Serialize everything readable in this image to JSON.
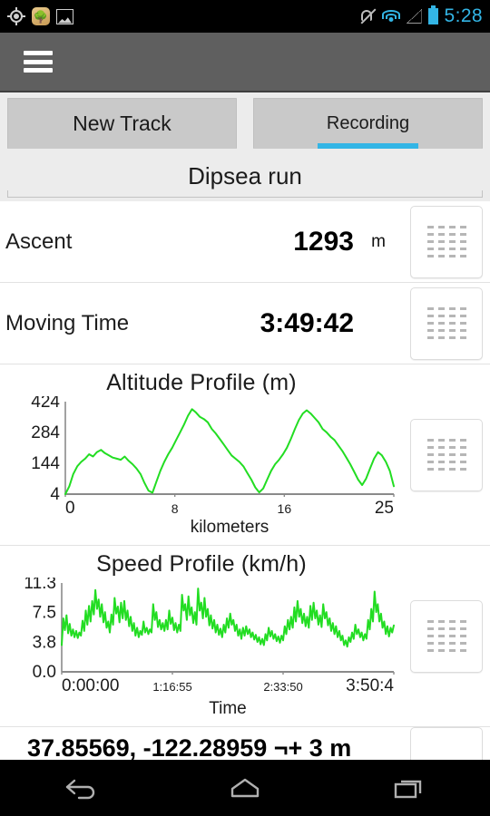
{
  "status_bar": {
    "time": "5:28",
    "left_icons": [
      "gps-crosshair-icon",
      "nature-app-icon",
      "photo-icon"
    ],
    "right_icons": [
      "mute-icon",
      "wifi-icon",
      "signal-icon",
      "battery-icon"
    ],
    "accent_color": "#33B5E5"
  },
  "action_bar": {
    "menu_icon": "hamburger-menu-icon",
    "background_color": "#5F5F5F"
  },
  "tabs": [
    {
      "label": "New Track",
      "active": false
    },
    {
      "label": "Recording",
      "active": true
    }
  ],
  "track": {
    "name": "Dipsea run"
  },
  "stats": [
    {
      "label": "Ascent",
      "value": "1293",
      "unit": "m"
    },
    {
      "label": "Moving Time",
      "value": "3:49:42",
      "unit": ""
    }
  ],
  "coordinates": {
    "text": "37.85569, -122.28959 ¬+ 3 m"
  },
  "side_icon": "drag-handle-grid-icon",
  "nav_bar": {
    "buttons": [
      "back-icon",
      "home-icon",
      "recents-icon"
    ]
  },
  "chart_data": [
    {
      "type": "line",
      "title": "Altitude Profile (m)",
      "xlabel": "kilometers",
      "ylabel": "",
      "line_color": "#22DD22",
      "grid": false,
      "legend": "none",
      "xticks": [
        "0",
        "8",
        "16",
        "25"
      ],
      "yticks": [
        "4",
        "144",
        "284",
        "424"
      ],
      "xlim": [
        0,
        25
      ],
      "ylim": [
        4,
        424
      ],
      "x": [
        0.0,
        0.3,
        0.6,
        0.9,
        1.2,
        1.5,
        1.8,
        2.1,
        2.4,
        2.7,
        3.0,
        3.3,
        3.6,
        3.9,
        4.2,
        4.5,
        4.8,
        5.1,
        5.4,
        5.7,
        6.0,
        6.3,
        6.6,
        6.9,
        7.2,
        7.5,
        7.8,
        8.1,
        8.4,
        8.7,
        9.0,
        9.3,
        9.6,
        9.9,
        10.2,
        10.5,
        10.8,
        11.1,
        11.4,
        11.7,
        12.0,
        12.3,
        12.6,
        12.9,
        13.2,
        13.5,
        13.8,
        14.1,
        14.4,
        14.7,
        15.0,
        15.3,
        15.6,
        15.9,
        16.2,
        16.5,
        16.8,
        17.1,
        17.4,
        17.7,
        18.0,
        18.3,
        18.6,
        18.9,
        19.2,
        19.5,
        19.8,
        20.1,
        20.4,
        20.7,
        21.0,
        21.3,
        21.6,
        21.9,
        22.2,
        22.5,
        22.8,
        23.1,
        23.4,
        23.7,
        24.0,
        24.3,
        24.6,
        25.0
      ],
      "values": [
        4,
        40,
        95,
        130,
        150,
        165,
        185,
        175,
        195,
        205,
        190,
        180,
        170,
        165,
        160,
        175,
        155,
        140,
        120,
        95,
        55,
        20,
        10,
        60,
        110,
        150,
        185,
        215,
        250,
        285,
        320,
        360,
        390,
        375,
        355,
        345,
        330,
        300,
        280,
        255,
        230,
        205,
        180,
        165,
        150,
        130,
        100,
        70,
        35,
        12,
        30,
        70,
        110,
        140,
        160,
        185,
        215,
        255,
        300,
        340,
        370,
        385,
        370,
        350,
        330,
        300,
        285,
        265,
        250,
        225,
        200,
        170,
        140,
        105,
        70,
        45,
        75,
        120,
        165,
        195,
        180,
        150,
        110,
        40
      ]
    },
    {
      "type": "line",
      "title": "Speed Profile (km/h)",
      "xlabel": "Time",
      "ylabel": "",
      "line_color": "#22DD22",
      "grid": false,
      "legend": "none",
      "xticks": [
        "0:00:00",
        "1:16:55",
        "2:33:50",
        "3:50:4"
      ],
      "yticks": [
        "0.0",
        "3.8",
        "7.5",
        "11.3"
      ],
      "xlim": [
        0,
        100
      ],
      "ylim": [
        0,
        11.3
      ],
      "values": [
        3.4,
        6.8,
        5.3,
        7.2,
        4.9,
        6.1,
        4.6,
        5.4,
        4.4,
        5.2,
        4.3,
        5.0,
        4.6,
        6.5,
        5.2,
        7.8,
        6.0,
        8.4,
        6.4,
        9.0,
        7.3,
        10.4,
        8.0,
        9.2,
        7.0,
        8.6,
        6.3,
        7.6,
        5.6,
        6.4,
        5.0,
        7.3,
        6.0,
        9.4,
        7.4,
        8.3,
        6.3,
        8.8,
        6.8,
        9.0,
        6.6,
        7.8,
        5.8,
        7.0,
        5.2,
        6.2,
        4.6,
        5.6,
        4.4,
        5.2,
        4.7,
        6.4,
        5.0,
        5.6,
        4.8,
        5.4,
        5.0,
        8.6,
        6.6,
        7.6,
        5.7,
        6.6,
        5.4,
        6.2,
        5.2,
        6.6,
        5.4,
        7.8,
        6.1,
        6.9,
        5.3,
        6.2,
        5.0,
        6.0,
        5.2,
        9.8,
        7.8,
        8.6,
        6.6,
        9.6,
        7.2,
        8.2,
        6.2,
        7.6,
        6.0,
        10.6,
        7.8,
        8.8,
        6.8,
        9.4,
        7.0,
        8.0,
        5.9,
        7.2,
        5.5,
        6.6,
        5.0,
        6.0,
        4.7,
        5.5,
        4.4,
        6.0,
        5.0,
        6.8,
        5.6,
        7.4,
        6.0,
        6.6,
        5.2,
        6.0,
        4.6,
        5.4,
        4.2,
        5.6,
        4.6,
        5.8,
        4.8,
        5.4,
        4.4,
        5.0,
        4.1,
        4.7,
        3.8,
        4.4,
        3.5,
        4.2,
        3.4,
        4.8,
        4.0,
        5.6,
        4.5,
        5.2,
        4.2,
        4.8,
        3.9,
        4.5,
        3.7,
        4.6,
        4.0,
        5.8,
        4.8,
        6.6,
        5.4,
        7.0,
        5.6,
        8.2,
        6.4,
        9.0,
        7.0,
        8.0,
        6.2,
        7.4,
        5.8,
        7.0,
        5.6,
        8.4,
        6.6,
        8.8,
        6.8,
        7.8,
        6.0,
        7.2,
        5.7,
        8.6,
        6.8,
        7.6,
        5.9,
        6.8,
        5.2,
        6.2,
        4.8,
        5.8,
        4.4,
        5.2,
        4.0,
        4.6,
        3.4,
        4.0,
        3.2,
        4.4,
        3.8,
        5.0,
        4.2,
        6.0,
        4.8,
        5.4,
        4.4,
        5.0,
        4.0,
        4.8,
        4.2,
        6.6,
        5.4,
        8.0,
        6.4,
        10.2,
        7.6,
        8.6,
        6.4,
        7.4,
        5.6,
        6.4,
        4.8,
        5.8,
        4.5,
        5.6,
        5.0,
        5.9
      ]
    }
  ]
}
